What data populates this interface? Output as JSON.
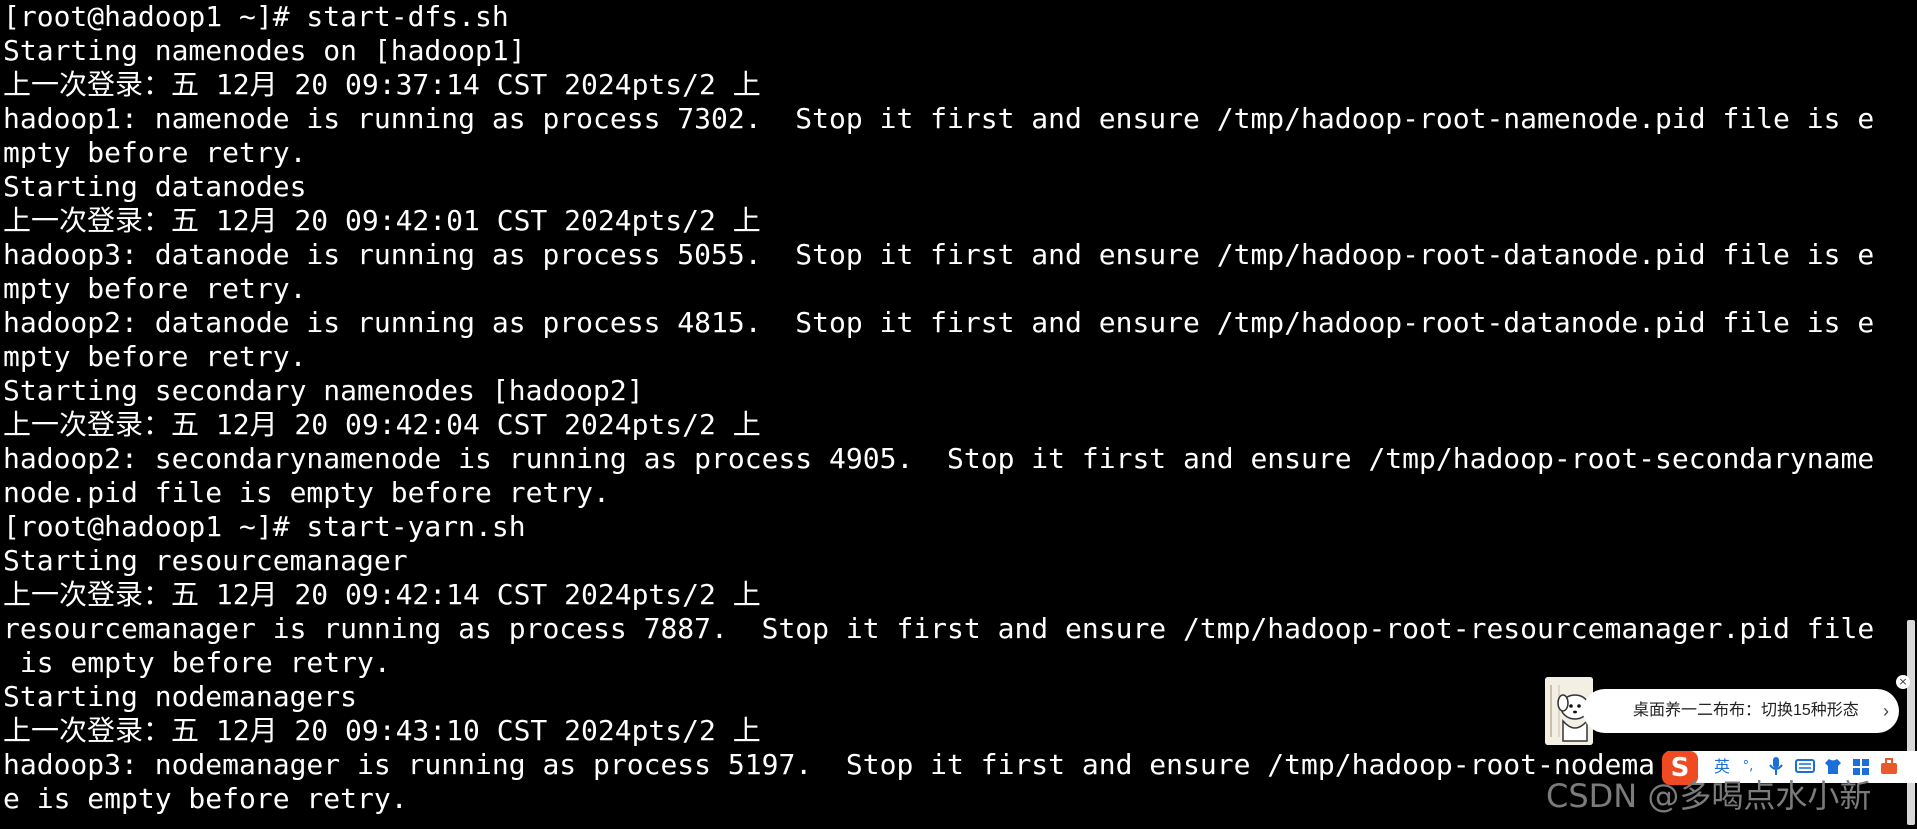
{
  "terminal": {
    "lines": [
      "[root@hadoop1 ~]# start-dfs.sh",
      "Starting namenodes on [hadoop1]",
      "上一次登录：五 12月 20 09:37:14 CST 2024pts/2 上",
      "hadoop1: namenode is running as process 7302.  Stop it first and ensure /tmp/hadoop-root-namenode.pid file is e",
      "mpty before retry.",
      "Starting datanodes",
      "上一次登录：五 12月 20 09:42:01 CST 2024pts/2 上",
      "hadoop3: datanode is running as process 5055.  Stop it first and ensure /tmp/hadoop-root-datanode.pid file is e",
      "mpty before retry.",
      "hadoop2: datanode is running as process 4815.  Stop it first and ensure /tmp/hadoop-root-datanode.pid file is e",
      "mpty before retry.",
      "Starting secondary namenodes [hadoop2]",
      "上一次登录：五 12月 20 09:42:04 CST 2024pts/2 上",
      "hadoop2: secondarynamenode is running as process 4905.  Stop it first and ensure /tmp/hadoop-root-secondaryname",
      "node.pid file is empty before retry.",
      "[root@hadoop1 ~]# start-yarn.sh",
      "Starting resourcemanager",
      "上一次登录：五 12月 20 09:42:14 CST 2024pts/2 上",
      "resourcemanager is running as process 7887.  Stop it first and ensure /tmp/hadoop-root-resourcemanager.pid file",
      " is empty before retry.",
      "Starting nodemanagers",
      "上一次登录：五 12月 20 09:43:10 CST 2024pts/2 上",
      "hadoop3: nodemanager is running as process 5197.  Stop it first and ensure /tmp/hadoop-root-nodema",
      "e is empty before retry."
    ]
  },
  "notification": {
    "text": "桌面养一二布布：切换15种形态",
    "chevron": "›",
    "close": "×",
    "avatar_icon": "cartoon-dog-avatar-icon"
  },
  "ime_toolbar": {
    "logo": "S",
    "lang": "英",
    "punct": "°,",
    "icons": [
      "microphone-icon",
      "keyboard-icon",
      "shirt-icon",
      "grid-icon",
      "toolbox-icon"
    ]
  },
  "watermark": "CSDN @多喝点水小新",
  "colors": {
    "background": "#000000",
    "foreground": "#ffffff",
    "ime_logo": "#f04a22",
    "ime_accent": "#1a6fd8"
  }
}
